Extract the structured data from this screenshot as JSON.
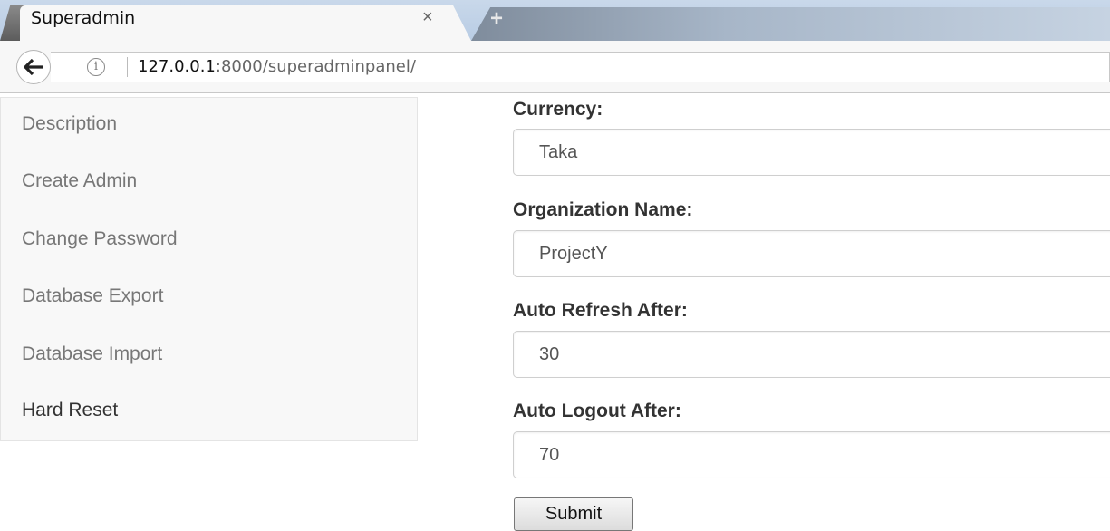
{
  "browser": {
    "tab_title": "Superadmin",
    "tab_close": "×",
    "new_tab": "+",
    "url_host": "127.0.0.1",
    "url_path": ":8000/superadminpanel/",
    "back_glyph": "🡐",
    "info_glyph": "i"
  },
  "sidebar": {
    "items": [
      {
        "label": "Description"
      },
      {
        "label": "Create Admin"
      },
      {
        "label": "Change Password"
      },
      {
        "label": "Database Export"
      },
      {
        "label": "Database Import"
      },
      {
        "label": "Hard Reset"
      }
    ]
  },
  "form": {
    "fields": [
      {
        "label": "Currency:",
        "value": "Taka"
      },
      {
        "label": "Organization Name:",
        "value": "ProjectY"
      },
      {
        "label": "Auto Refresh After:",
        "value": "30"
      },
      {
        "label": "Auto Logout After:",
        "value": "70"
      }
    ],
    "submit_label": "Submit"
  },
  "colors": {
    "sidebar_bg": "#f8f8f8",
    "label_text": "#333333",
    "muted_text": "#777777"
  }
}
